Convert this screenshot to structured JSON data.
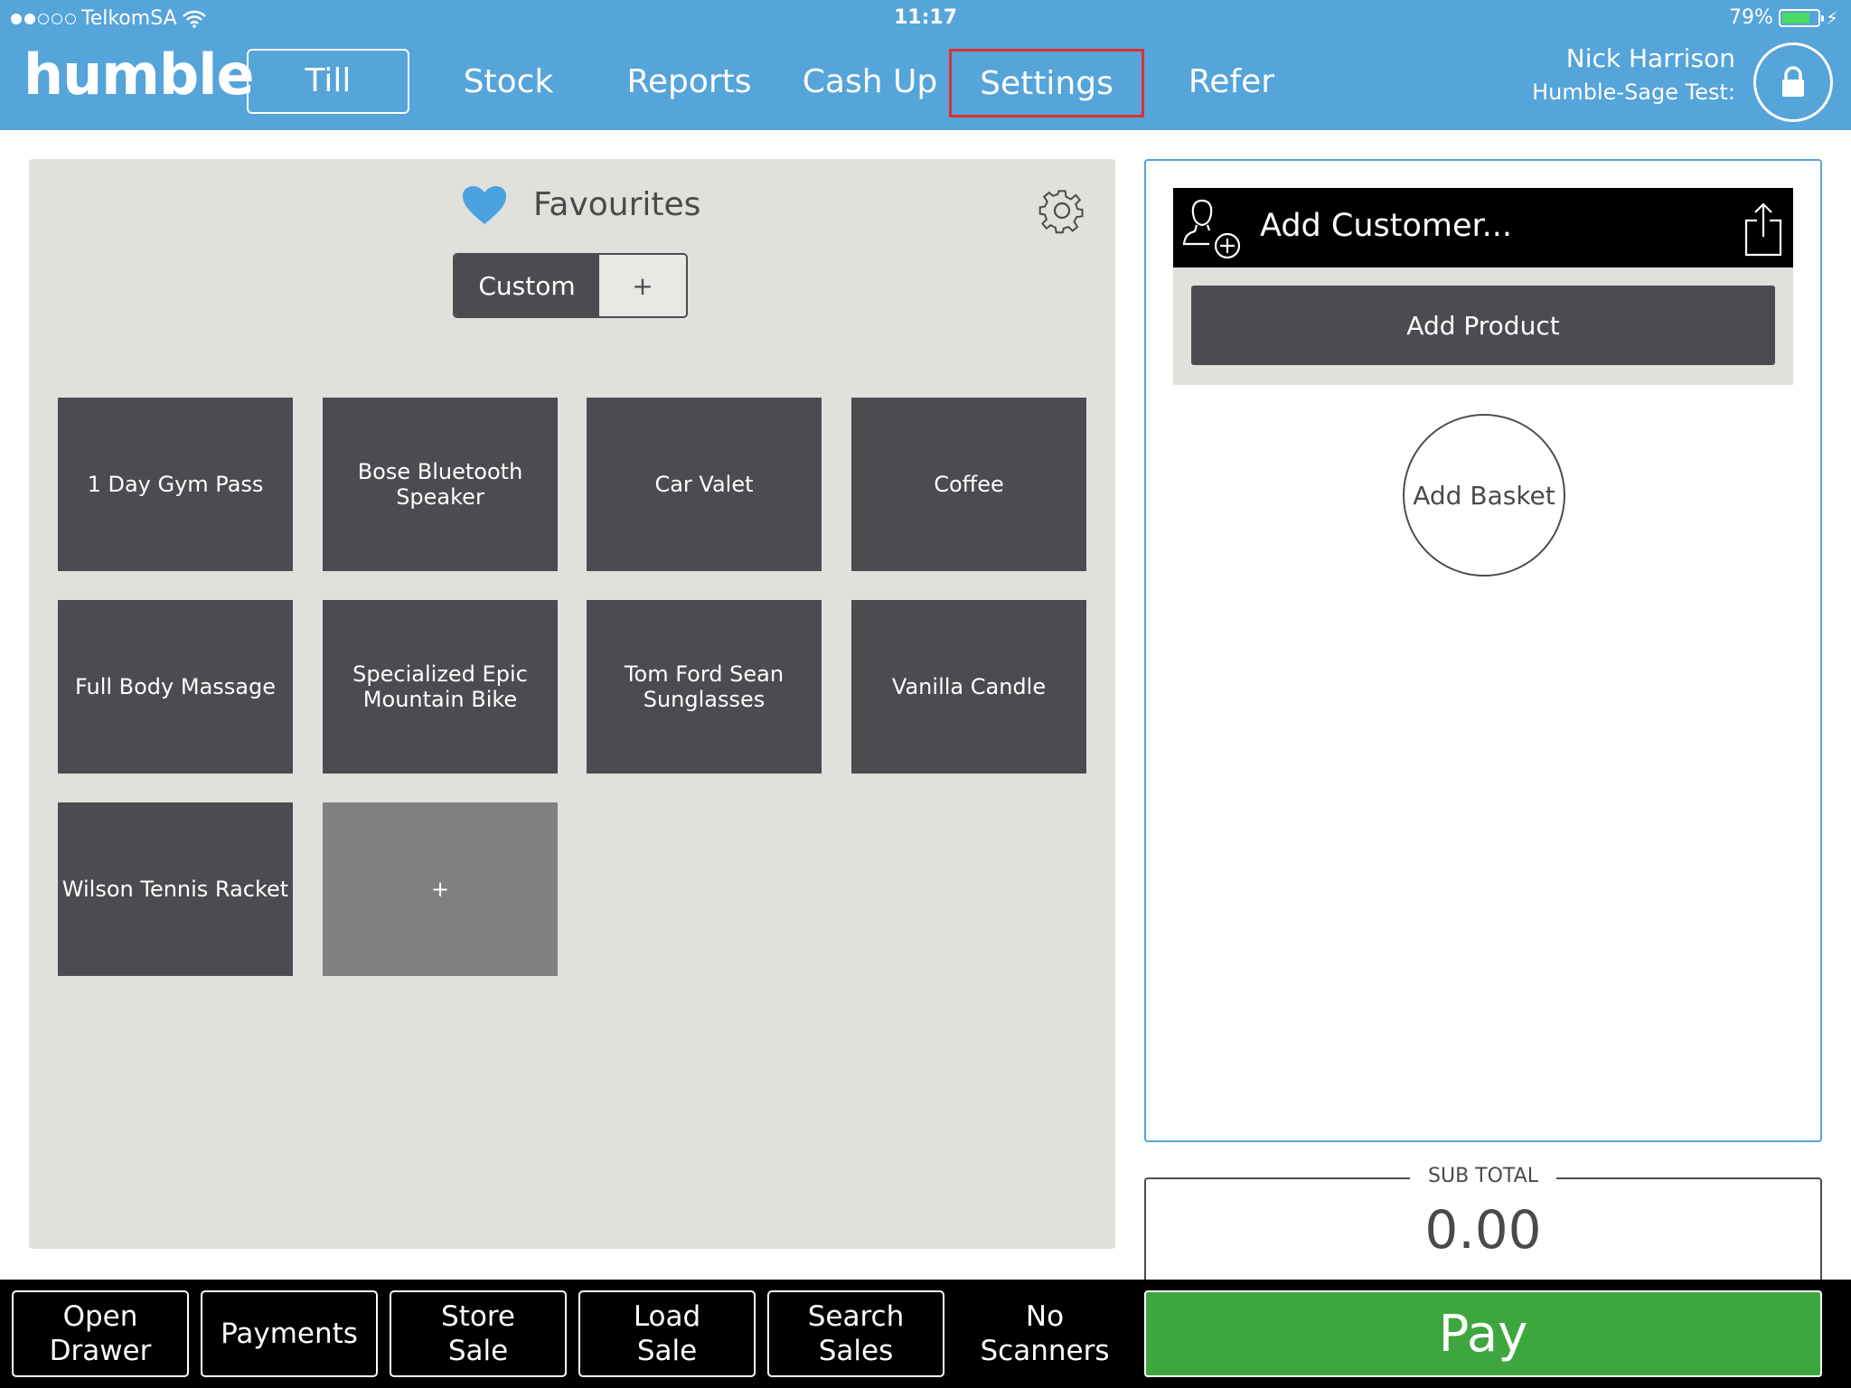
{
  "status": {
    "carrier": "TelkomSA",
    "time": "11:17",
    "battery": "79%"
  },
  "header": {
    "logo": "humble",
    "nav": {
      "till": "Till",
      "stock": "Stock",
      "reports": "Reports",
      "cash_up": "Cash Up",
      "settings": "Settings",
      "refer": "Refer"
    },
    "user_name": "Nick Harrison",
    "user_org": "Humble-Sage Test:"
  },
  "favourites": {
    "title": "Favourites",
    "tab_custom": "Custom",
    "tab_add": "+",
    "tiles": [
      "1 Day Gym Pass",
      "Bose Bluetooth Speaker",
      "Car Valet",
      "Coffee",
      "Full Body Massage",
      "Specialized Epic Mountain Bike",
      "Tom Ford Sean Sunglasses",
      "Vanilla Candle",
      "Wilson Tennis Racket"
    ],
    "add_tile": "+"
  },
  "basket": {
    "add_customer": "Add Customer...",
    "add_product": "Add Product",
    "add_basket": "Add Basket"
  },
  "subtotal": {
    "label": "SUB TOTAL",
    "value": "0.00"
  },
  "bottom": {
    "open_drawer": "Open\nDrawer",
    "payments": "Payments",
    "store_sale": "Store\nSale",
    "load_sale": "Load\nSale",
    "search_sales": "Search\nSales",
    "no_scanners": "No\nScanners",
    "pay": "Pay"
  },
  "colors": {
    "header": "#55a4da",
    "tile": "#4b4c50",
    "pay": "#3ea63e",
    "highlight": "#e03030"
  }
}
